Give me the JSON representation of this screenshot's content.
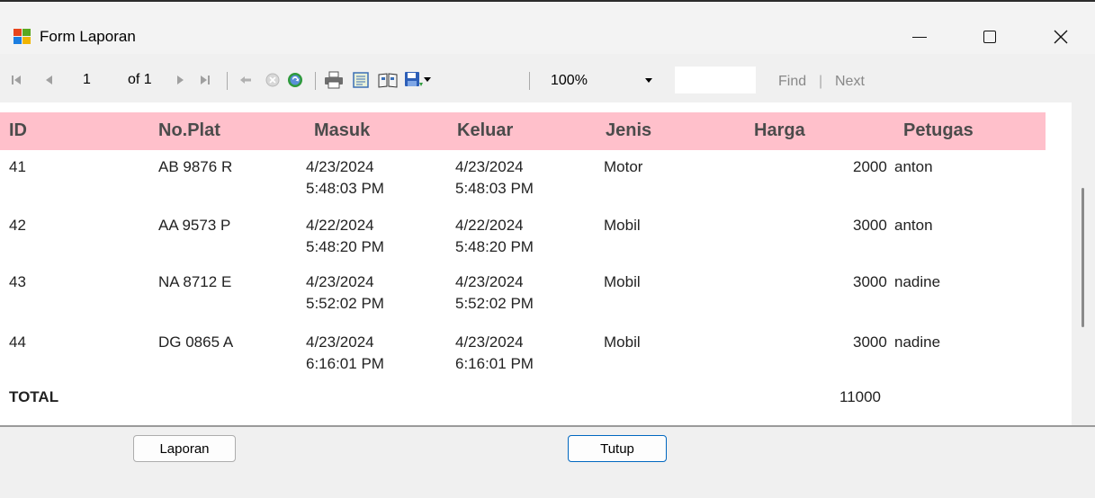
{
  "window": {
    "title": "Form Laporan"
  },
  "toolbar": {
    "page_current": "1",
    "page_of": "of 1",
    "zoom": "100%",
    "find_label": "Find",
    "find_sep": "|",
    "next_label": "Next"
  },
  "report": {
    "columns": [
      "ID",
      "No.Plat",
      "Masuk",
      "Keluar",
      "Jenis",
      "Harga",
      "Petugas"
    ],
    "rows": [
      {
        "id": "41",
        "plat": "AB 9876 R",
        "masuk_date": "4/23/2024",
        "masuk_time": "5:48:03 PM",
        "keluar_date": "4/23/2024",
        "keluar_time": "5:48:03 PM",
        "jenis": "Motor",
        "harga": "2000",
        "petugas": "anton"
      },
      {
        "id": "42",
        "plat": "AA 9573 P",
        "masuk_date": "4/22/2024",
        "masuk_time": "5:48:20 PM",
        "keluar_date": "4/22/2024",
        "keluar_time": "5:48:20 PM",
        "jenis": "Mobil",
        "harga": "3000",
        "petugas": "anton"
      },
      {
        "id": "43",
        "plat": "NA 8712 E",
        "masuk_date": "4/23/2024",
        "masuk_time": "5:52:02 PM",
        "keluar_date": "4/23/2024",
        "keluar_time": "5:52:02 PM",
        "jenis": "Mobil",
        "harga": "3000",
        "petugas": "nadine"
      },
      {
        "id": "44",
        "plat": "DG 0865 A",
        "masuk_date": "4/23/2024",
        "masuk_time": "6:16:01 PM",
        "keluar_date": "4/23/2024",
        "keluar_time": "6:16:01 PM",
        "jenis": "Mobil",
        "harga": "3000",
        "petugas": "nadine"
      }
    ],
    "total_label": "TOTAL",
    "total_value": "11000"
  },
  "buttons": {
    "laporan": "Laporan",
    "tutup": "Tutup"
  },
  "colors": {
    "header_bg": "#ffc0cb",
    "accent": "#0067c0"
  }
}
